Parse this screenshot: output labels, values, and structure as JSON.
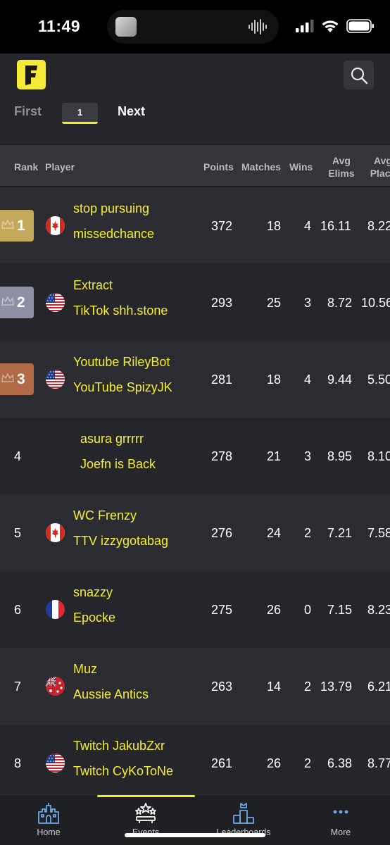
{
  "status_bar": {
    "time": "11:49"
  },
  "header": {
    "logo_letter": "F"
  },
  "pager": {
    "first": "First",
    "current": "1",
    "next": "Next"
  },
  "columns": {
    "rank": "Rank",
    "player": "Player",
    "points": "Points",
    "matches": "Matches",
    "wins": "Wins",
    "avg_elims_line1": "Avg",
    "avg_elims_line2": "Elims",
    "avg_place_line1": "Avg",
    "avg_place_line2": "Place"
  },
  "rows": [
    {
      "rank": "1",
      "players": [
        "stop pursuing",
        "missedchance"
      ],
      "points": "372",
      "matches": "18",
      "wins": "4",
      "avg_elims": "16.11",
      "avg_place": "8.22",
      "flag": "canada",
      "badge_color": "#c4a95a"
    },
    {
      "rank": "2",
      "players": [
        "Extract",
        "TikTok shh.stone"
      ],
      "points": "293",
      "matches": "25",
      "wins": "3",
      "avg_elims": "8.72",
      "avg_place": "10.56",
      "flag": "usa",
      "badge_color": "#8d8fa3"
    },
    {
      "rank": "3",
      "players": [
        "Youtube RileyBot",
        "YouTube SpizyJK"
      ],
      "points": "281",
      "matches": "18",
      "wins": "4",
      "avg_elims": "9.44",
      "avg_place": "5.50",
      "flag": "usa",
      "badge_color": "#b06a45"
    },
    {
      "rank": "4",
      "players": [
        "asura grrrrr",
        "Joefn is Back"
      ],
      "points": "278",
      "matches": "21",
      "wins": "3",
      "avg_elims": "8.95",
      "avg_place": "8.10",
      "flag": "none"
    },
    {
      "rank": "5",
      "players": [
        "WC Frenzy",
        "TTV izzygotabag"
      ],
      "points": "276",
      "matches": "24",
      "wins": "2",
      "avg_elims": "7.21",
      "avg_place": "7.58",
      "flag": "canada"
    },
    {
      "rank": "6",
      "players": [
        "snazzy",
        "Epocke"
      ],
      "points": "275",
      "matches": "26",
      "wins": "0",
      "avg_elims": "7.15",
      "avg_place": "8.23",
      "flag": "france"
    },
    {
      "rank": "7",
      "players": [
        "Muz",
        "Aussie Antics"
      ],
      "points": "263",
      "matches": "14",
      "wins": "2",
      "avg_elims": "13.79",
      "avg_place": "6.21",
      "flag": "australia"
    },
    {
      "rank": "8",
      "players": [
        "Twitch JakubZxr",
        "Twitch CyKoToNe"
      ],
      "points": "261",
      "matches": "26",
      "wins": "2",
      "avg_elims": "6.38",
      "avg_place": "8.77",
      "flag": "usa"
    }
  ],
  "tabbar": {
    "home": "Home",
    "events": "Events",
    "leaderboards": "Leaderboards",
    "more": "More",
    "active": "events",
    "icons": [
      "castle-icon",
      "events-stars-icon",
      "podium-icon",
      "more-dots-icon"
    ]
  },
  "colors": {
    "accent": "#f5ea35",
    "player_text": "#f7ee2f",
    "tab_icon": "#6fa6e6"
  }
}
